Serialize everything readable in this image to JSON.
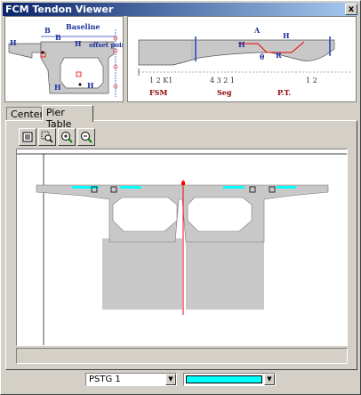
{
  "window": {
    "title": "FCM Tendon Viewer",
    "close_label": "x"
  },
  "diagram_left": {
    "labels": {
      "baseline": "Baseline",
      "offset_point": "offset point",
      "b1": "B",
      "b2": "B",
      "h1": "H",
      "h2": "H",
      "h3": "H",
      "h4": "H"
    }
  },
  "diagram_right": {
    "labels": {
      "a": "A",
      "hi": "H",
      "hr": "H",
      "theta": "θ",
      "ri": "R",
      "fsm": "FSM",
      "seg": "Seg",
      "pt": "P.T."
    },
    "segments_left": "1 2 K1",
    "segments_mid": "4 3 2 1",
    "segments_right": "1 2"
  },
  "tabs": [
    {
      "label": "Center"
    },
    {
      "label": "Pier Table"
    }
  ],
  "toolbar": {
    "buttons": [
      "select-icon",
      "zoom-window-icon",
      "zoom-in-icon",
      "zoom-out-icon"
    ]
  },
  "footer": {
    "tendon_select": {
      "value": "PSTG 1"
    },
    "color_select": {
      "value": "#00ffff"
    }
  },
  "colors": {
    "tendon": "#00ffff",
    "centerline": "#ff0000",
    "section": "#c8c8c8"
  }
}
